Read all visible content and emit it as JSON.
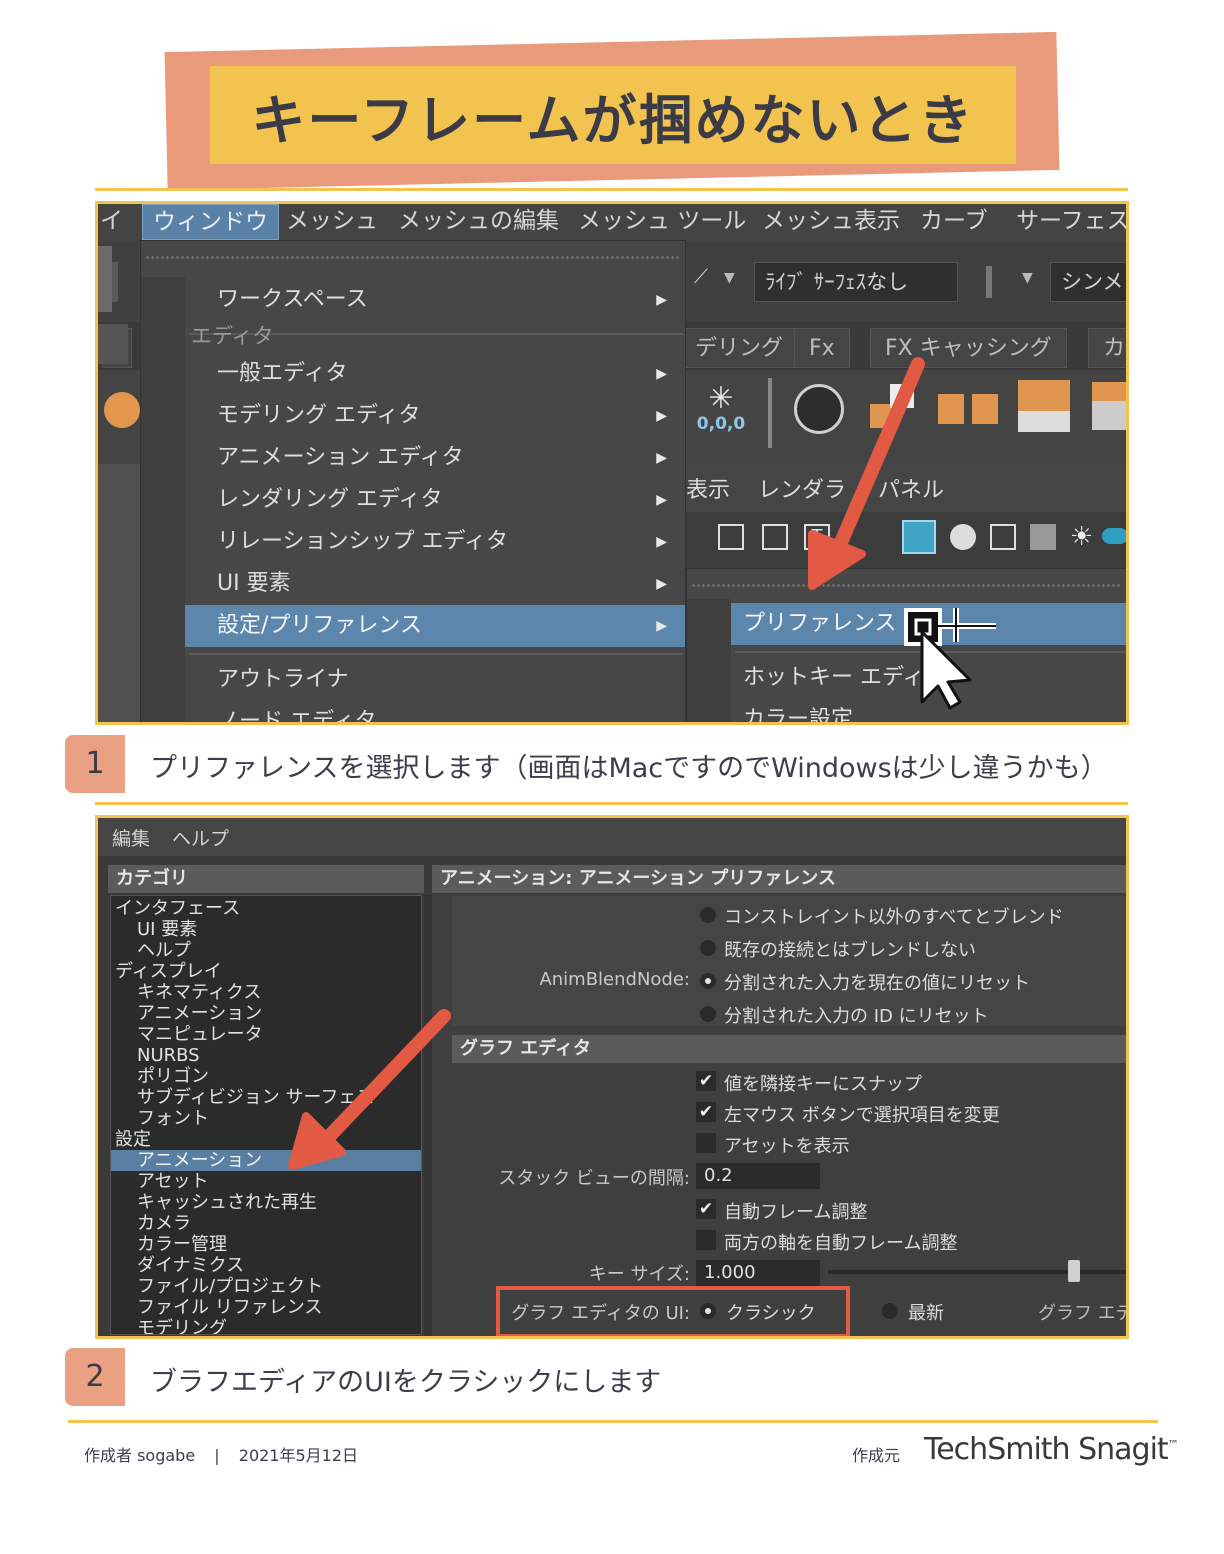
{
  "title": "キーフレームが掴めないとき",
  "colors": {
    "banner_yellow": "#f2c34f",
    "banner_salmon": "#e99a7a",
    "arrow_red": "#e25a43",
    "highlight_blue": "#5d86ad"
  },
  "screenshot1": {
    "menubar": [
      "イ",
      "ウィンドウ",
      "メッシュ",
      "メッシュの編集",
      "メッシュ ツール",
      "メッシュ表示",
      "カーブ",
      "サーフェス"
    ],
    "toolbar": {
      "live_surface": "ﾗｲﾌﾞ ｻｰﾌｪｽなし",
      "symmetry": "シンメ"
    },
    "shelf_tabs": [
      "デリング",
      "Fx",
      "FX キャッシング",
      "カ"
    ],
    "snowflake_label": "0,0,0",
    "panel_menu": [
      "表示",
      "レンダラ",
      "パネル"
    ],
    "window_menu": [
      {
        "label": "ワークスペース",
        "arrow": "▶"
      },
      {
        "label": "エディタ",
        "header": true
      },
      {
        "label": "一般エディタ",
        "arrow": "▶"
      },
      {
        "label": "モデリング エディタ",
        "arrow": "▶"
      },
      {
        "label": "アニメーション エディタ",
        "arrow": "▶"
      },
      {
        "label": "レンダリング エディタ",
        "arrow": "▶"
      },
      {
        "label": "リレーションシップ エディタ",
        "arrow": "▶"
      },
      {
        "label": "UI 要素",
        "arrow": "▶"
      },
      {
        "label": "設定/プリファレンス",
        "arrow": "▶",
        "selected": true
      },
      {
        "label": "アウトライナ"
      },
      {
        "label": "ノード エディタ"
      }
    ],
    "submenu": [
      {
        "label": "プリファレンス",
        "selected": true
      },
      {
        "label": "ホットキー エディタ"
      },
      {
        "label": "カラー設定"
      }
    ]
  },
  "step1": {
    "number": "1",
    "text": "プリファレンスを選択します（画面はMacですのでWindowsは少し違うかも）"
  },
  "screenshot2": {
    "menubar": [
      "編集",
      "ヘルプ"
    ],
    "category_header": "カテゴリ",
    "pref_header": "アニメーション: アニメーション プリファレンス",
    "categories": [
      {
        "label": "インタフェース",
        "indent": 0
      },
      {
        "label": "UI 要素",
        "indent": 1
      },
      {
        "label": "ヘルプ",
        "indent": 1
      },
      {
        "label": "ディスプレイ",
        "indent": 0
      },
      {
        "label": "キネマティクス",
        "indent": 1
      },
      {
        "label": "アニメーション",
        "indent": 1
      },
      {
        "label": "マニピュレータ",
        "indent": 1
      },
      {
        "label": "NURBS",
        "indent": 1
      },
      {
        "label": "ポリゴン",
        "indent": 1
      },
      {
        "label": "サブディビジョン サーフェス",
        "indent": 1
      },
      {
        "label": "フォント",
        "indent": 1
      },
      {
        "label": "設定",
        "indent": 0
      },
      {
        "label": "アニメーション",
        "indent": 1,
        "selected": true
      },
      {
        "label": "アセット",
        "indent": 1
      },
      {
        "label": "キャッシュされた再生",
        "indent": 1
      },
      {
        "label": "カメラ",
        "indent": 1
      },
      {
        "label": "カラー管理",
        "indent": 1
      },
      {
        "label": "ダイナミクス",
        "indent": 1
      },
      {
        "label": "ファイル/プロジェクト",
        "indent": 1
      },
      {
        "label": "ファイル リファレンス",
        "indent": 1
      },
      {
        "label": "モデリング",
        "indent": 1
      }
    ],
    "animblend_label": "AnimBlendNode:",
    "animblend_options": [
      {
        "label": "コンストレイント以外のすべてとブレンド",
        "on": false
      },
      {
        "label": "既存の接続とはブレンドしない",
        "on": false
      },
      {
        "label": "分割された入力を現在の値にリセット",
        "on": true
      },
      {
        "label": "分割された入力の ID にリセット",
        "on": false
      }
    ],
    "graph_section": "グラフ エディタ",
    "graph_checks": [
      {
        "label": "値を隣接キーにスナップ",
        "checked": true
      },
      {
        "label": "左マウス ボタンで選択項目を変更",
        "checked": true
      },
      {
        "label": "アセットを表示",
        "checked": false
      }
    ],
    "stack_label": "スタック ビューの間隔:",
    "stack_value": "0.2",
    "frame_checks": [
      {
        "label": "自動フレーム調整",
        "checked": true
      },
      {
        "label": "両方の軸を自動フレーム調整",
        "checked": false
      }
    ],
    "key_size_label": "キー サイズ:",
    "key_size_value": "1.000",
    "ui_label": "グラフ エディタの UI:",
    "ui_classic": "クラシック",
    "ui_latest": "最新",
    "ui_cut": "グラフ エデ",
    "check_mark": "✔"
  },
  "step2": {
    "number": "2",
    "text": "ブラフエディアのUIをクラシックにします"
  },
  "footer": {
    "author": "作成者 sogabe",
    "separator": "|",
    "date": "2021年5月12日",
    "made_with": "作成元",
    "brand": "TechSmith Snagit",
    "trademark": "™"
  }
}
